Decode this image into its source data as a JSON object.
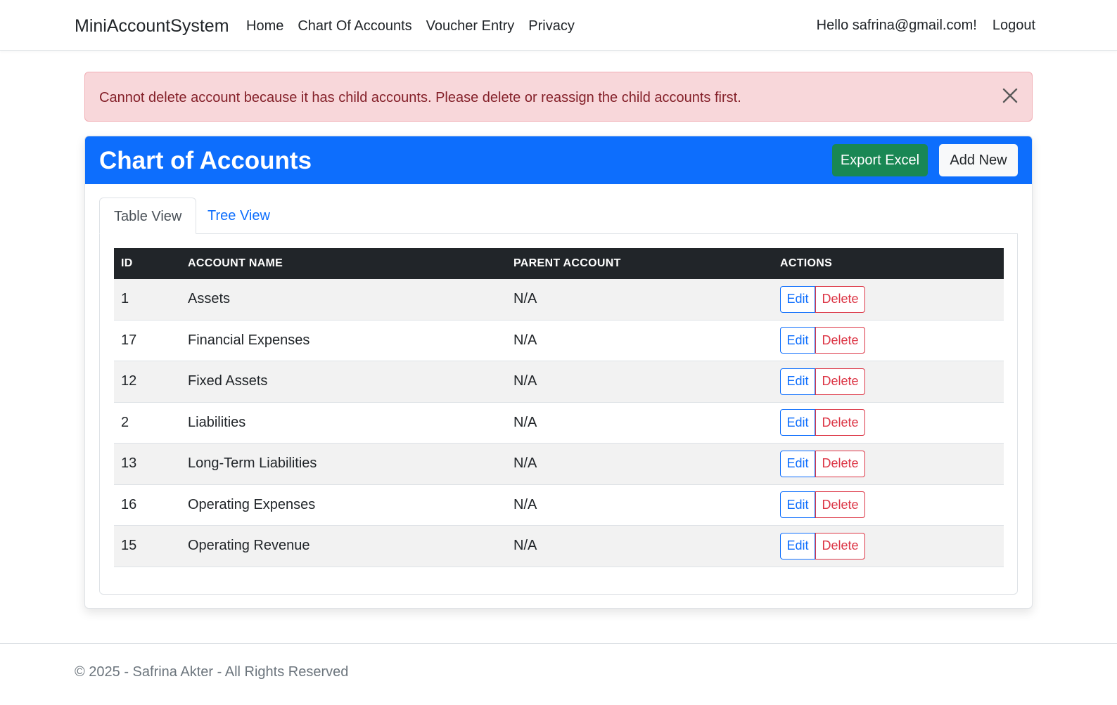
{
  "navbar": {
    "brand": "MiniAccountSystem",
    "links": [
      "Home",
      "Chart Of Accounts",
      "Voucher Entry",
      "Privacy"
    ],
    "greeting": "Hello safrina@gmail.com!",
    "logout": "Logout"
  },
  "alert": {
    "message": "Cannot delete account because it has child accounts. Please delete or reassign the child accounts first."
  },
  "card": {
    "title": "Chart of Accounts",
    "export_label": "Export Excel",
    "add_label": "Add New"
  },
  "tabs": [
    "Table View",
    "Tree View"
  ],
  "table": {
    "headers": [
      "ID",
      "ACCOUNT NAME",
      "PARENT ACCOUNT",
      "ACTIONS"
    ],
    "rows": [
      {
        "id": "1",
        "name": "Assets",
        "parent": "N/A"
      },
      {
        "id": "17",
        "name": "Financial Expenses",
        "parent": "N/A"
      },
      {
        "id": "12",
        "name": "Fixed Assets",
        "parent": "N/A"
      },
      {
        "id": "2",
        "name": "Liabilities",
        "parent": "N/A"
      },
      {
        "id": "13",
        "name": "Long-Term Liabilities",
        "parent": "N/A"
      },
      {
        "id": "16",
        "name": "Operating Expenses",
        "parent": "N/A"
      },
      {
        "id": "15",
        "name": "Operating Revenue",
        "parent": "N/A"
      }
    ],
    "edit_label": "Edit",
    "delete_label": "Delete"
  },
  "footer": {
    "text": "© 2025 - Safrina Akter - All Rights Reserved"
  },
  "colors": {
    "primary": "#0d6efd",
    "success": "#198754",
    "danger": "#dc3545",
    "alert_bg": "#f8d7da",
    "alert_text": "#842029",
    "table_header": "#212529"
  }
}
